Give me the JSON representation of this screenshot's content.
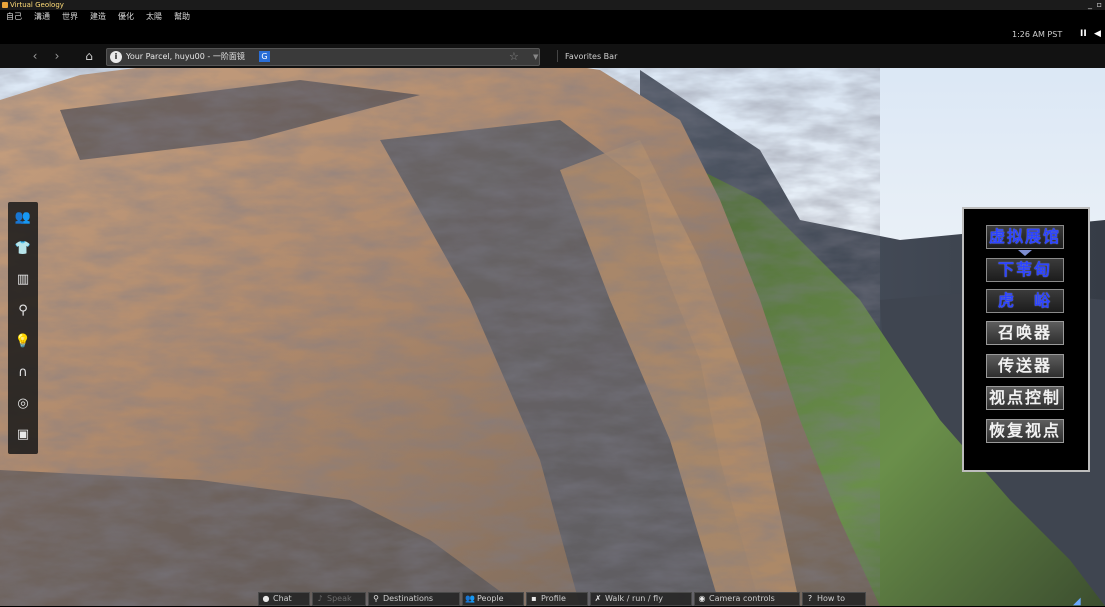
{
  "window": {
    "title": "Virtual Geology",
    "controls": "_ ▫"
  },
  "menu": [
    "自己",
    "溝通",
    "世界",
    "建造",
    "優化",
    "太陽",
    "幫助"
  ],
  "status": {
    "clock": "1:26 AM PST"
  },
  "nav": {
    "back": "‹",
    "forward": "›",
    "home": "⌂",
    "address": "Your Parcel, huyu00 - 一阶面镜",
    "badge": "G",
    "favorites": "Favorites Bar"
  },
  "left_toolbar": [
    "people-icon",
    "shirt-icon",
    "map-icon",
    "search-icon",
    "light-icon",
    "headset-icon",
    "radio-icon",
    "camera-icon"
  ],
  "right_panel": {
    "buttons": [
      {
        "label": "虚拟展馆",
        "style": "blue"
      },
      {
        "label": "下苇甸",
        "style": "blue"
      },
      {
        "label": "虎　峪",
        "style": "blue"
      },
      {
        "label": "召唤器",
        "style": "white"
      },
      {
        "label": "传送器",
        "style": "white"
      },
      {
        "label": "视点控制",
        "style": "white"
      },
      {
        "label": "恢复视点",
        "style": "white"
      }
    ]
  },
  "bottom_bar": {
    "chat": "Chat",
    "speak": "Speak",
    "destinations": "Destinations",
    "people": "People",
    "profile": "Profile",
    "walk": "Walk / run / fly",
    "camera": "Camera controls",
    "howto": "How to"
  },
  "colors": {
    "panel_blue_text": "#2c43ff",
    "titlebar_text": "#ffdc78"
  }
}
